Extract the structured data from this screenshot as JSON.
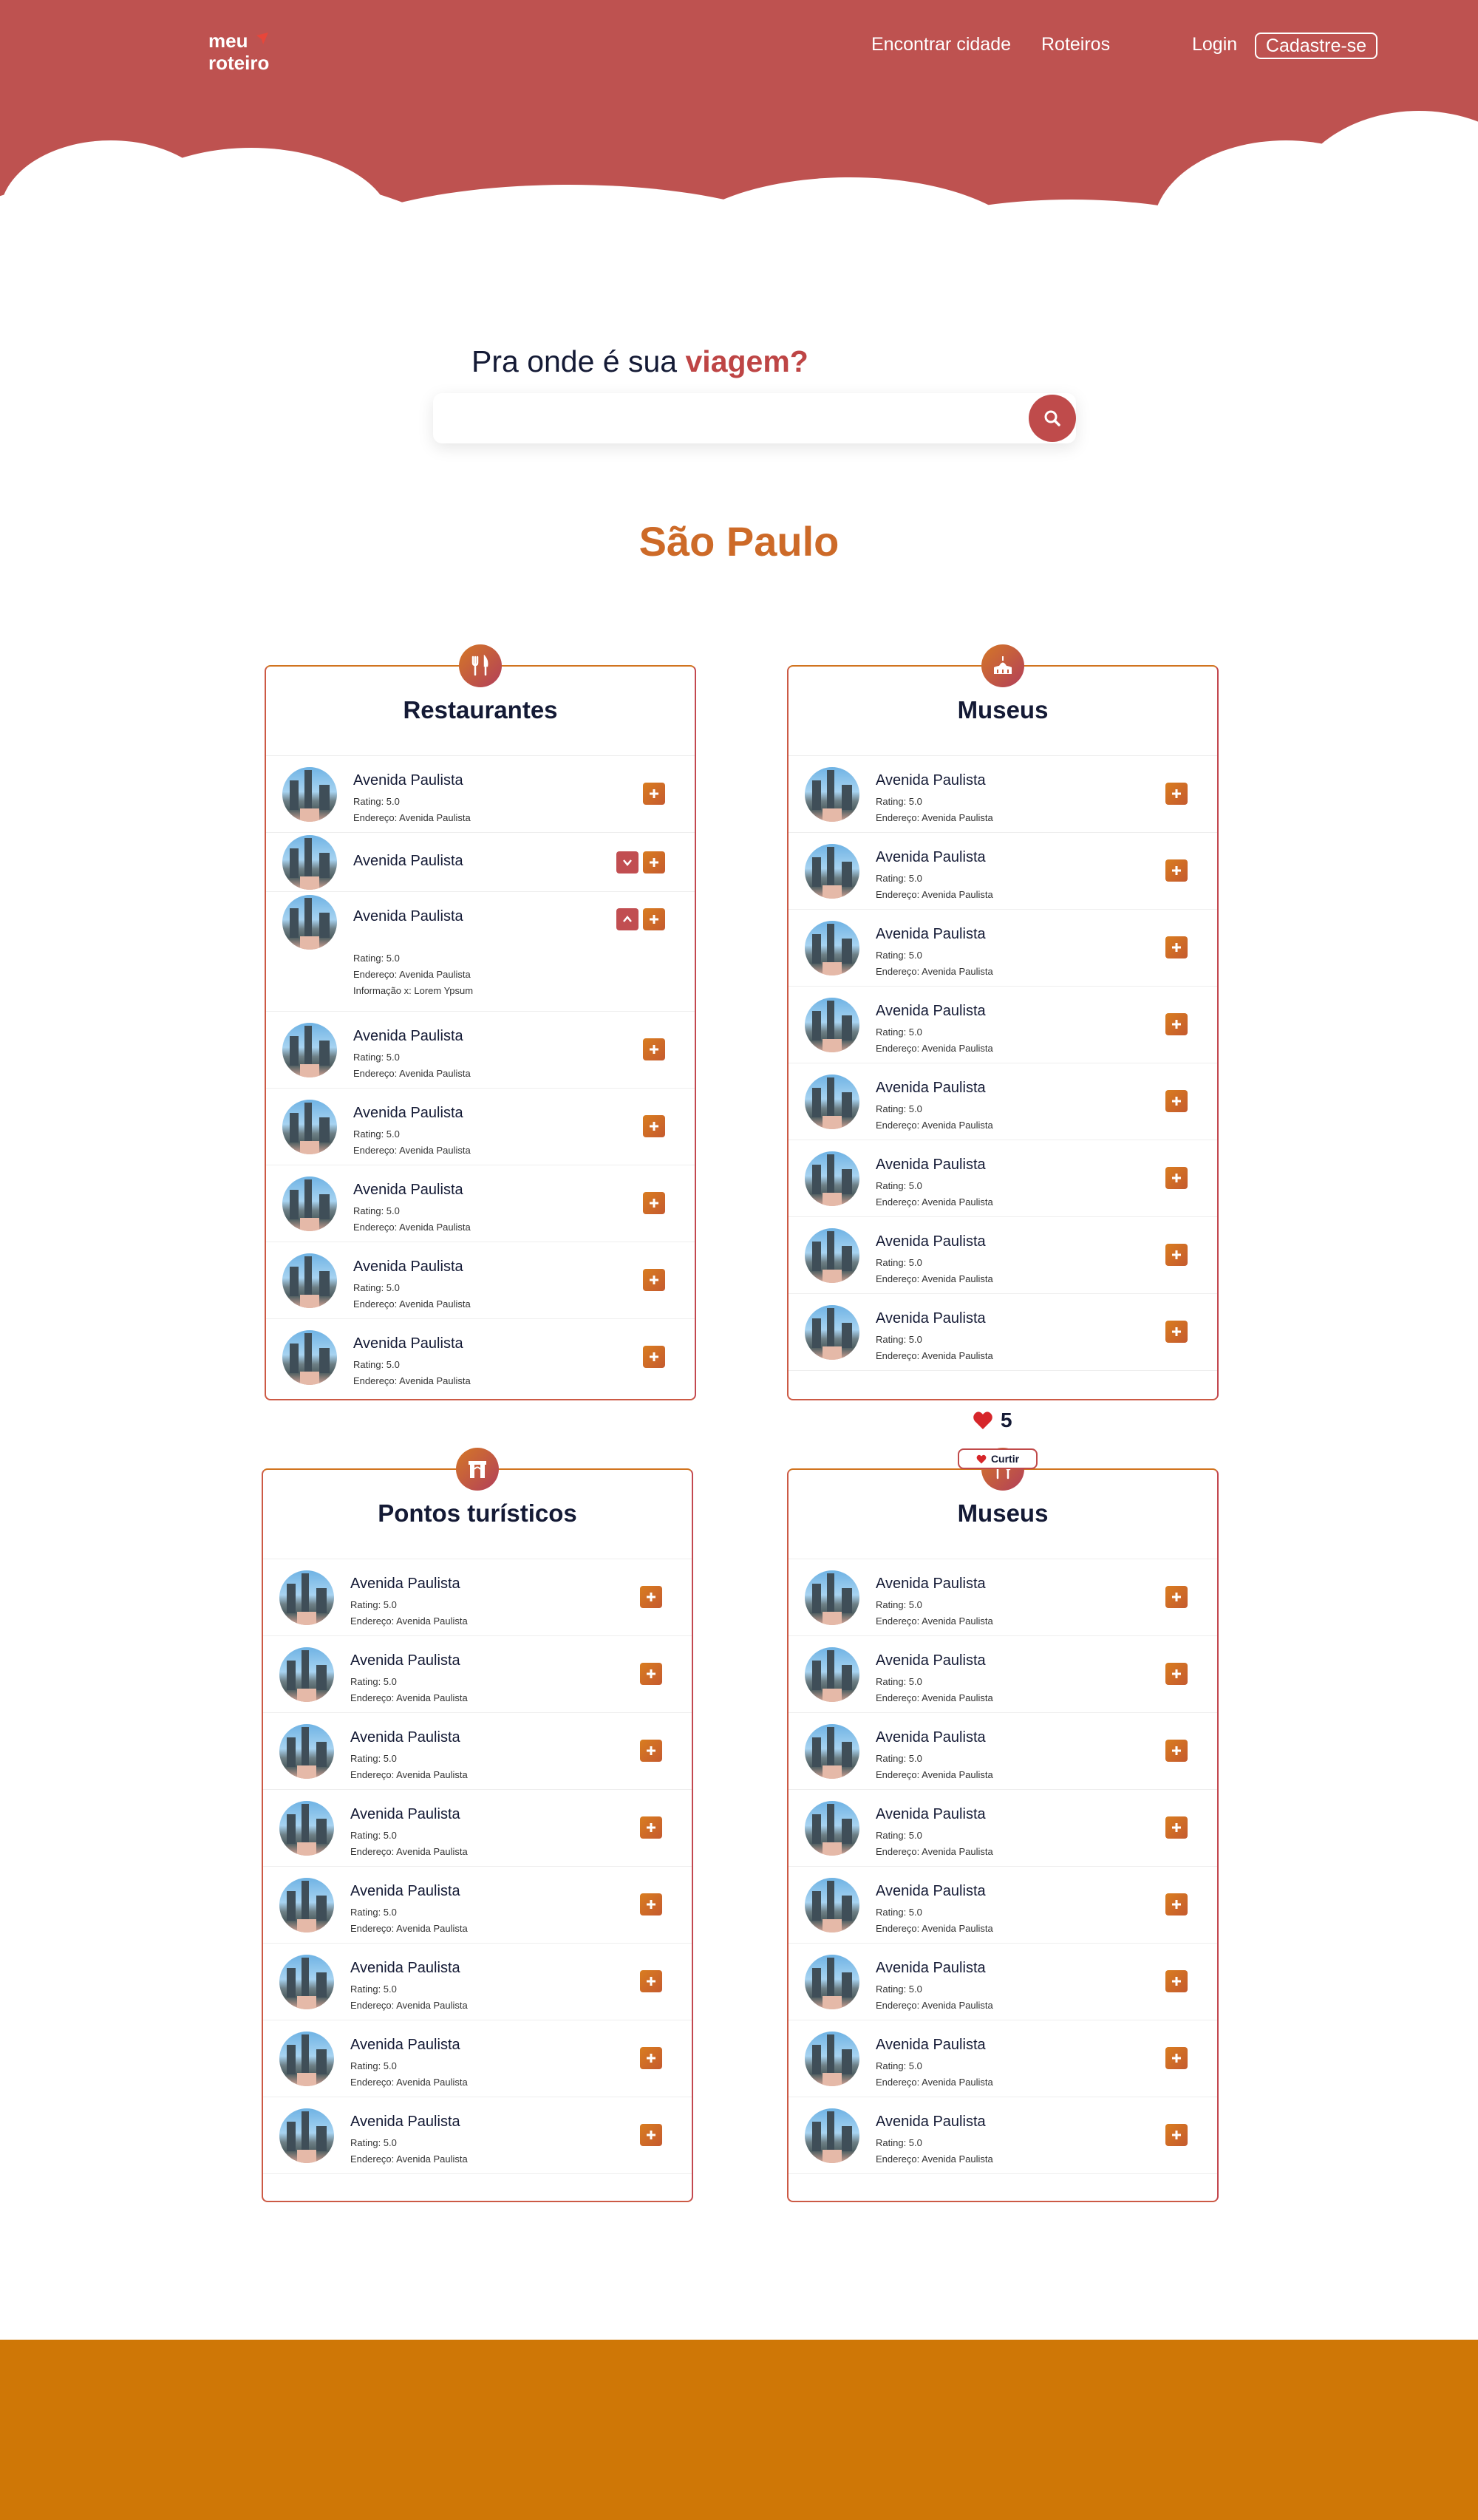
{
  "header": {
    "logo_line1": "meu",
    "logo_line2": "roteiro",
    "nav": [
      "Encontrar cidade",
      "Roteiros"
    ],
    "login": "Login",
    "signup": "Cadastre-se"
  },
  "search": {
    "prompt": "Pra onde é sua",
    "prompt_accent": "viagem?",
    "placeholder": "",
    "value": ""
  },
  "city": "São Paulo",
  "likes": {
    "count": "5",
    "button_label": "Curtir"
  },
  "colors": {
    "header_bg": "#be5250",
    "accent_orange": "#cd6a28",
    "accent_red": "#be4545",
    "footer_bg": "#cf7706"
  },
  "cards": [
    {
      "title": "Restaurantes",
      "icon": "fork-knife-icon",
      "items": [
        {
          "name": "Avenida Paulista",
          "rating": "Rating: 5.0",
          "address": "Endereço: Avenida Paulista"
        },
        {
          "name": "Avenida Paulista"
        },
        {
          "name": "Avenida Paulista",
          "rating": "Rating: 5.0",
          "address": "Endereço: Avenida Paulista",
          "info": "Informação x: Lorem Ypsum"
        },
        {
          "name": "Avenida Paulista",
          "rating": "Rating: 5.0",
          "address": "Endereço: Avenida Paulista"
        },
        {
          "name": "Avenida Paulista",
          "rating": "Rating: 5.0",
          "address": "Endereço: Avenida Paulista"
        },
        {
          "name": "Avenida Paulista",
          "rating": "Rating: 5.0",
          "address": "Endereço: Avenida Paulista"
        },
        {
          "name": "Avenida Paulista",
          "rating": "Rating: 5.0",
          "address": "Endereço: Avenida Paulista"
        },
        {
          "name": "Avenida Paulista",
          "rating": "Rating: 5.0",
          "address": "Endereço: Avenida Paulista"
        }
      ]
    },
    {
      "title": "Museus",
      "icon": "museum-icon",
      "items": [
        {
          "name": "Avenida Paulista",
          "rating": "Rating: 5.0",
          "address": "Endereço: Avenida Paulista"
        },
        {
          "name": "Avenida Paulista",
          "rating": "Rating: 5.0",
          "address": "Endereço: Avenida Paulista"
        },
        {
          "name": "Avenida Paulista",
          "rating": "Rating: 5.0",
          "address": "Endereço: Avenida Paulista"
        },
        {
          "name": "Avenida Paulista",
          "rating": "Rating: 5.0",
          "address": "Endereço: Avenida Paulista"
        },
        {
          "name": "Avenida Paulista",
          "rating": "Rating: 5.0",
          "address": "Endereço: Avenida Paulista"
        },
        {
          "name": "Avenida Paulista",
          "rating": "Rating: 5.0",
          "address": "Endereço: Avenida Paulista"
        },
        {
          "name": "Avenida Paulista",
          "rating": "Rating: 5.0",
          "address": "Endereço: Avenida Paulista"
        },
        {
          "name": "Avenida Paulista",
          "rating": "Rating: 5.0",
          "address": "Endereço: Avenida Paulista"
        }
      ]
    },
    {
      "title": "Pontos turísticos",
      "icon": "arch-icon",
      "items": [
        {
          "name": "Avenida Paulista",
          "rating": "Rating: 5.0",
          "address": "Endereço: Avenida Paulista"
        },
        {
          "name": "Avenida Paulista",
          "rating": "Rating: 5.0",
          "address": "Endereço: Avenida Paulista"
        },
        {
          "name": "Avenida Paulista",
          "rating": "Rating: 5.0",
          "address": "Endereço: Avenida Paulista"
        },
        {
          "name": "Avenida Paulista",
          "rating": "Rating: 5.0",
          "address": "Endereço: Avenida Paulista"
        },
        {
          "name": "Avenida Paulista",
          "rating": "Rating: 5.0",
          "address": "Endereço: Avenida Paulista"
        },
        {
          "name": "Avenida Paulista",
          "rating": "Rating: 5.0",
          "address": "Endereço: Avenida Paulista"
        },
        {
          "name": "Avenida Paulista",
          "rating": "Rating: 5.0",
          "address": "Endereço: Avenida Paulista"
        },
        {
          "name": "Avenida Paulista",
          "rating": "Rating: 5.0",
          "address": "Endereço: Avenida Paulista"
        }
      ]
    },
    {
      "title": "Museus",
      "icon": "fork-knife-icon",
      "items": [
        {
          "name": "Avenida Paulista",
          "rating": "Rating: 5.0",
          "address": "Endereço: Avenida Paulista"
        },
        {
          "name": "Avenida Paulista",
          "rating": "Rating: 5.0",
          "address": "Endereço: Avenida Paulista"
        },
        {
          "name": "Avenida Paulista",
          "rating": "Rating: 5.0",
          "address": "Endereço: Avenida Paulista"
        },
        {
          "name": "Avenida Paulista",
          "rating": "Rating: 5.0",
          "address": "Endereço: Avenida Paulista"
        },
        {
          "name": "Avenida Paulista",
          "rating": "Rating: 5.0",
          "address": "Endereço: Avenida Paulista"
        },
        {
          "name": "Avenida Paulista",
          "rating": "Rating: 5.0",
          "address": "Endereço: Avenida Paulista"
        },
        {
          "name": "Avenida Paulista",
          "rating": "Rating: 5.0",
          "address": "Endereço: Avenida Paulista"
        },
        {
          "name": "Avenida Paulista",
          "rating": "Rating: 5.0",
          "address": "Endereço: Avenida Paulista"
        }
      ]
    }
  ]
}
